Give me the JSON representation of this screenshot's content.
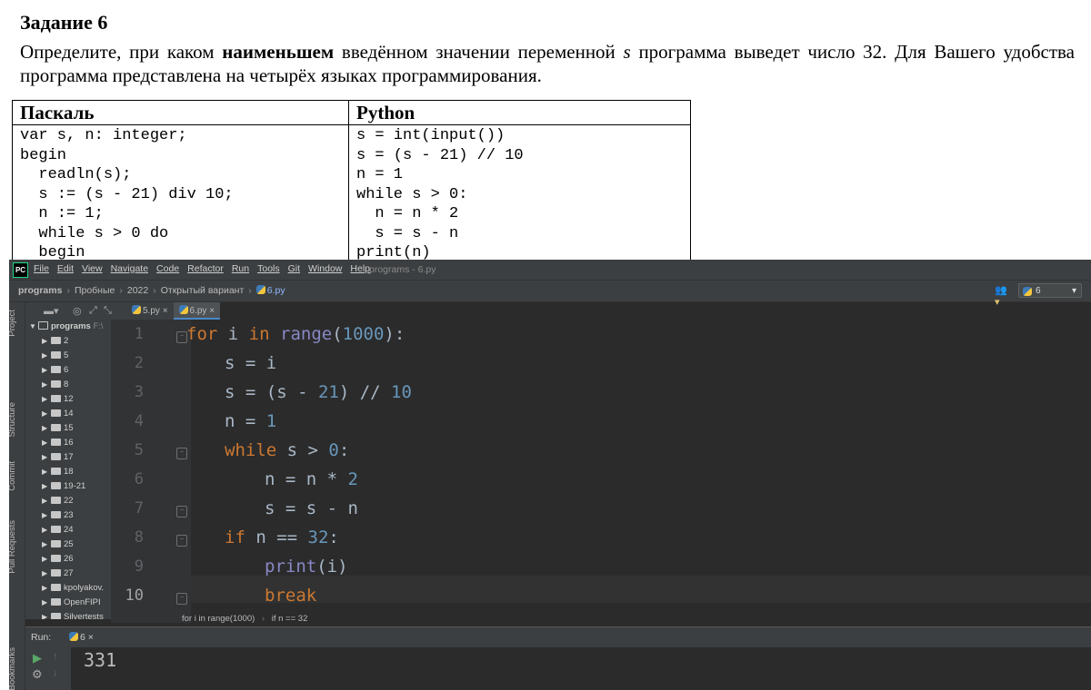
{
  "document": {
    "title": "Задание 6",
    "text_part1": "Определите, при каком ",
    "text_bold": "наименьшем",
    "text_part2": " введённом значении переменной ",
    "text_var": "s",
    "text_part3": " программа выведет число 32. Для Вашего удобства программа представлена на четырёх языках программирования.",
    "pascal_header": "Паскаль",
    "pascal_code": "var s, n: integer;\nbegin\n  readln(s);\n  s := (s - 21) div 10;\n  n := 1;\n  while s > 0 do\n  begin",
    "python_header": "Python",
    "python_code": "s = int(input())\ns = (s - 21) // 10\nn = 1\nwhile s > 0:\n  n = n * 2\n  s = s - n\nprint(n)"
  },
  "ide": {
    "logo": "PC",
    "menu": [
      "File",
      "Edit",
      "View",
      "Navigate",
      "Code",
      "Refactor",
      "Run",
      "Tools",
      "Git",
      "Window",
      "Help"
    ],
    "window_title": "programs - 6.py",
    "breadcrumbs": [
      "programs",
      "Пробные",
      "2022",
      "Открытый вариант",
      "6.py"
    ],
    "run_config": "6",
    "tabs": [
      "5.py",
      "6.py"
    ],
    "side_tabs": [
      "Project",
      "Structure",
      "Commit",
      "Pull Requests",
      "Bookmarks"
    ],
    "project_root": "programs",
    "project_root_path": "F:\\",
    "project_items": [
      "2",
      "5",
      "6",
      "8",
      "12",
      "14",
      "15",
      "16",
      "17",
      "18",
      "19-21",
      "22",
      "23",
      "24",
      "25",
      "26",
      "27",
      "kpolyakov.",
      "OpenFIPI",
      "Silvertests"
    ],
    "line_numbers": [
      "1",
      "2",
      "3",
      "4",
      "5",
      "6",
      "7",
      "8",
      "9",
      "10"
    ],
    "code_breadcrumb": [
      "for i in range(1000)",
      "if n == 32"
    ],
    "run_label": "Run:",
    "run_tab": "6",
    "output": "331"
  },
  "colors": {
    "ide_bg": "#2b2b2b",
    "panel_bg": "#3c3f41",
    "keyword": "#cc7832",
    "number": "#6897bb",
    "builtin": "#8888c6",
    "text": "#a9b7c6"
  }
}
